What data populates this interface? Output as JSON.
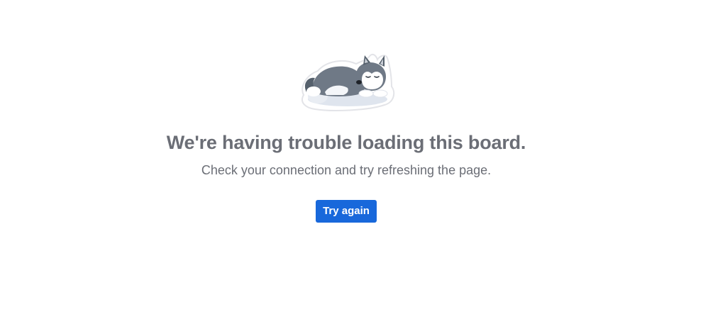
{
  "illustration": {
    "icon": "sleeping-husky-icon"
  },
  "error": {
    "title": "We're having trouble loading this board.",
    "message": "Check your connection and try refreshing the page."
  },
  "actions": {
    "retry_label": "Try again"
  },
  "colors": {
    "text": "#6b6e76",
    "button": "#1868db",
    "button_text": "#ffffff"
  }
}
